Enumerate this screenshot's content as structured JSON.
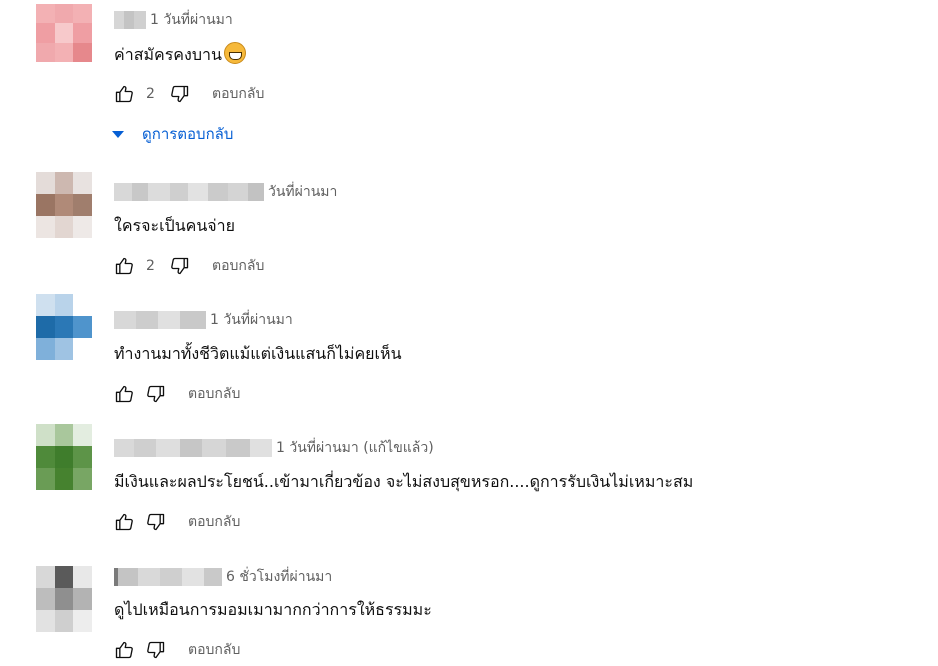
{
  "reply_label": "ตอบกลับ",
  "comments": [
    {
      "username_hint": "ดดด",
      "time": "1 วันที่ผ่านมา",
      "text": "ค่าสมัครคงบาน",
      "likes": "2",
      "view_replies": "ดูการตอบกลับ"
    },
    {
      "time": "วันที่ผ่านมา",
      "text": "ใครจะเป็นคนจ่าย",
      "likes": "2"
    },
    {
      "time": "1 วันที่ผ่านมา",
      "text": "ทำงานมาทั้งชีวิตแม้แต่เงินแสนก็ไม่คยเห็น",
      "likes": ""
    },
    {
      "time": "1 วันที่ผ่านมา (แก้ไขแล้ว)",
      "text": "มีเงินและผลประโยชน์..เข้ามาเกี่ยวข้อง จะไม่สงบสุขหรอก....ดูการรับเงินไม่เหมาะสม",
      "likes": ""
    },
    {
      "time": "6 ชั่วโมงที่ผ่านมา",
      "text": "ดูไปเหมือนการมอมเมามากกว่าการให้ธรรมมะ",
      "likes": ""
    }
  ],
  "icons": {
    "like": "thumb-up-icon",
    "dislike": "thumb-down-icon",
    "expand": "triangle-down-icon",
    "emoji": "grinning-face-icon"
  },
  "colors": {
    "link_blue": "#065fd4",
    "secondary_text": "#606060",
    "primary_text": "#0f0f0f"
  }
}
